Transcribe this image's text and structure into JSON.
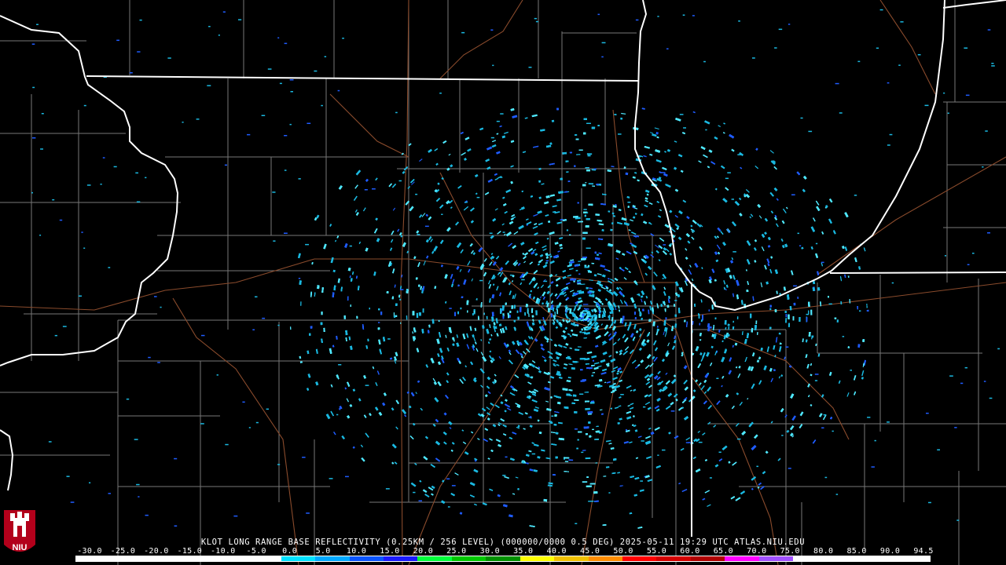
{
  "product": {
    "caption": "KLOT LONG RANGE BASE REFLECTIVITY (0.25KM / 256 LEVEL) (000000/0000 0.5 DEG) 2025-05-11 19:29 UTC  ATLAS.NIU.EDU"
  },
  "logo": {
    "text": "NIU",
    "colors": {
      "seal": "#b3001b",
      "tower": "#ffffff"
    }
  },
  "map_layers": [
    "state-boundaries",
    "county-boundaries",
    "highways",
    "lake-michigan-shoreline"
  ],
  "colors": {
    "background": "#000000",
    "state_border": "#ffffff",
    "county_border": "#7a7a7a",
    "highway": "#8b4a2b",
    "echo_primary": "#1ab8e0",
    "echo_light": "#4fe8ff",
    "echo_blue": "#1f5cff"
  },
  "legend": {
    "labels": [
      "-30.0",
      "-25.0",
      "-20.0",
      "-15.0",
      "-10.0",
      "-5.0",
      "0.0",
      "5.0",
      "10.0",
      "15.0",
      "20.0",
      "25.0",
      "30.0",
      "35.0",
      "40.0",
      "45.0",
      "50.0",
      "55.0",
      "60.0",
      "65.0",
      "70.0",
      "75.0",
      "80.0",
      "85.0",
      "90.0",
      "94.5"
    ],
    "min": -30.0,
    "max": 94.5,
    "color_stops": [
      "#ffffff",
      "#ffffff",
      "#ffffff",
      "#ffffff",
      "#ffffff",
      "#ffffff",
      "#00e0ff",
      "#00a8ff",
      "#0a54ff",
      "#1a1aff",
      "#00ff3a",
      "#00c800",
      "#009000",
      "#ffff00",
      "#f0c000",
      "#ff8c00",
      "#ff0000",
      "#d40000",
      "#b00000",
      "#ff00ff",
      "#a050ff",
      "#ffffff",
      "#ffffff",
      "#ffffff",
      "#ffffff"
    ]
  },
  "echo_field": {
    "radar_site": "KLOT",
    "elevation_deg": 0.5,
    "dominant_range_dbz": [
      0.0,
      10.0
    ]
  }
}
